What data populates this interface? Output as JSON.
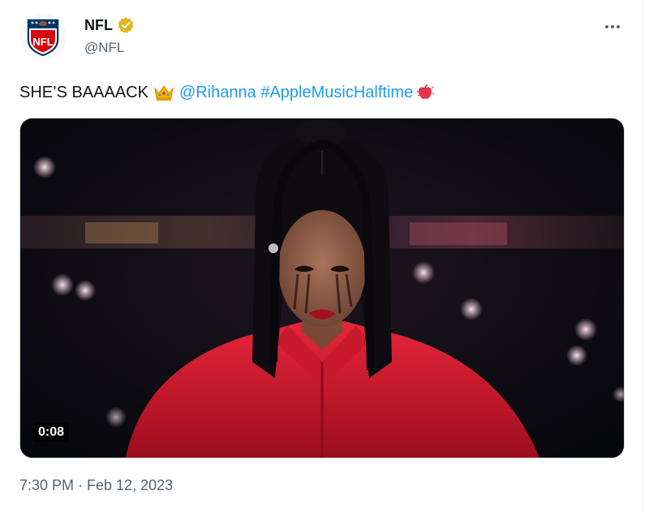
{
  "tweet": {
    "author": {
      "display_name": "NFL",
      "handle": "@NFL",
      "verified": true,
      "avatar_icon": "nfl-shield-logo"
    },
    "text": {
      "lead": "SHE’S BAAAACK",
      "emoji_1": "crown-emoji",
      "mention": "@Rihanna",
      "hashtag": "#AppleMusicHalftime",
      "emoji_2": "apple-music-emoji"
    },
    "media": {
      "type": "video",
      "duration": "0:08"
    },
    "timestamp": "7:30 PM · Feb 12, 2023",
    "colors": {
      "link": "#1d9bf0",
      "text_primary": "#0f1419",
      "text_secondary": "#536471",
      "verified_badge": "#e2b719"
    }
  }
}
